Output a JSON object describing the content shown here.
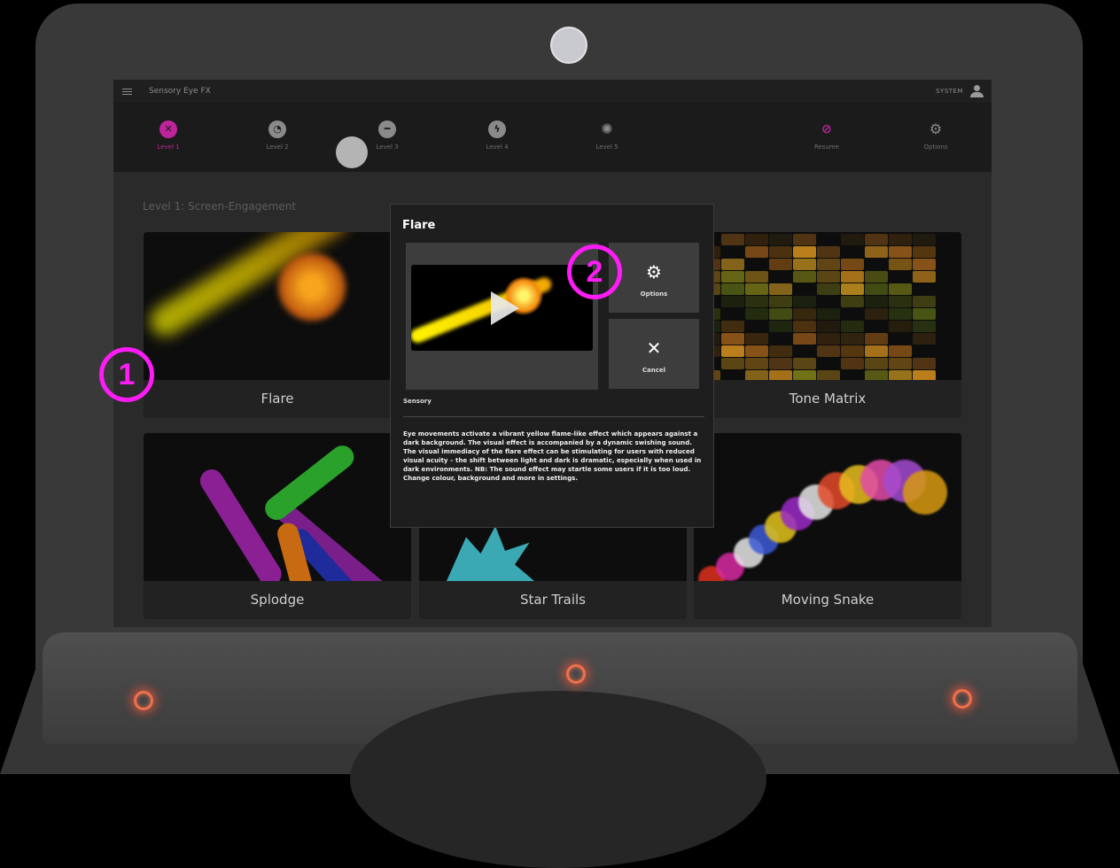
{
  "topbar": {
    "app_title": "Sensory Eye FX",
    "system_label": "SYSTEM"
  },
  "levels": [
    {
      "label": "Level 1",
      "icon": "close-circle-icon",
      "active": true
    },
    {
      "label": "Level 2",
      "icon": "target-icon",
      "active": false
    },
    {
      "label": "Level 3",
      "icon": "half-circle-icon",
      "active": false
    },
    {
      "label": "Level 4",
      "icon": "lightning-icon",
      "active": false
    },
    {
      "label": "Level 5",
      "icon": "web-icon",
      "active": false
    }
  ],
  "actions": [
    {
      "label": "Resume",
      "icon": "eye-off-icon"
    },
    {
      "label": "Options",
      "icon": "gear-icon"
    }
  ],
  "section_title": "Level 1: Screen-Engagement",
  "cards": [
    {
      "label": "Flare"
    },
    {
      "label": "Tone Matrix"
    },
    {
      "label": "Splodge"
    },
    {
      "label": "Star Trails"
    },
    {
      "label": "Moving Snake"
    }
  ],
  "modal": {
    "title": "Flare",
    "category": "Sensory",
    "description": "Eye movements activate a vibrant yellow flame-like effect which appears against a dark background. The visual effect is accompanied by a dynamic swishing sound. The visual immediacy of the flare effect can be stimulating for users with reduced visual acuity – the shift between light and dark is dramatic, especially when used in dark environments. NB: The sound effect may startle some users if it is too loud. Change colour, background and more in settings.",
    "options_label": "Options",
    "cancel_label": "Cancel"
  },
  "callouts": [
    "1",
    "2"
  ],
  "colors": {
    "accent": "#c0249c",
    "callout": "#ff1cf6",
    "sensor": "#f36f4c"
  }
}
